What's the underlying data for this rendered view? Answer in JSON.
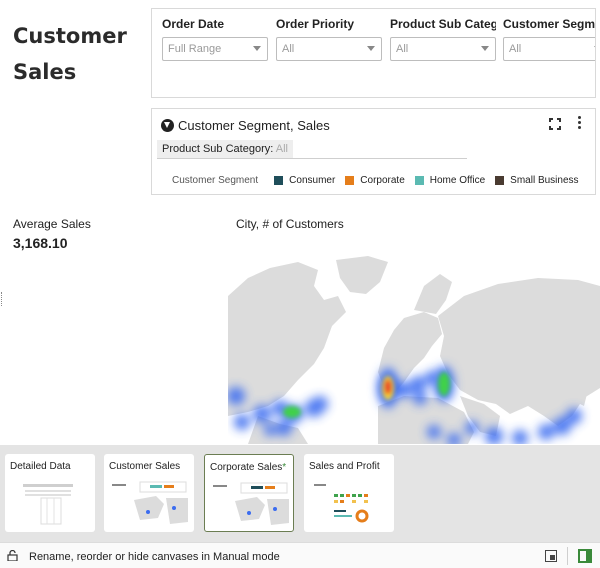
{
  "page": {
    "title": "Customer Sales"
  },
  "filters": [
    {
      "label": "Order Date",
      "value": "Full Range"
    },
    {
      "label": "Order Priority",
      "value": "All"
    },
    {
      "label": "Product Sub Categ...",
      "value": "All"
    },
    {
      "label": "Customer Segmen",
      "value": "All"
    }
  ],
  "viz": {
    "title": "Customer Segment, Sales",
    "filter_pill_label": "Product Sub Category:",
    "filter_pill_value": "All",
    "legend_title": "Customer Segment",
    "legend": [
      {
        "name": "Consumer",
        "color": "#1f4e5a"
      },
      {
        "name": "Corporate",
        "color": "#e57e1b"
      },
      {
        "name": "Home Office",
        "color": "#5bbab2"
      },
      {
        "name": "Small Business",
        "color": "#4a3b31"
      }
    ]
  },
  "kpi": {
    "label": "Average Sales",
    "value": "3,168.10"
  },
  "map": {
    "title": "City, # of Customers",
    "colors": {
      "land": "#dcdcdc",
      "ocean": "#ffffff",
      "heat_low": "#3b6cf0",
      "heat_mid": "#3fd14a",
      "heat_high": "#e8402c"
    }
  },
  "canvases": [
    {
      "label": "Detailed Data",
      "active": false
    },
    {
      "label": "Customer Sales",
      "active": false
    },
    {
      "label": "Corporate Sales",
      "active": true,
      "modified_marker": "*"
    },
    {
      "label": "Sales and Profit",
      "active": false
    }
  ],
  "status": {
    "text": "Rename, reorder or hide canvases in Manual mode"
  }
}
